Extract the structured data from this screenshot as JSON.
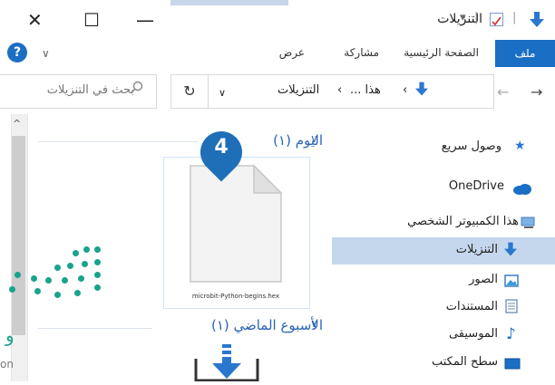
{
  "window": {
    "title": "التنزيلات",
    "minimize_glyph": "—",
    "maximize_glyph": "☐",
    "close_glyph": "✕",
    "accent_color": "#1a6fc4",
    "qa_separator": "|",
    "qa_arrow": "▾"
  },
  "ribbon": {
    "tabs": [
      "ملف",
      "الصفحة الرئيسية",
      "مشاركة",
      "عرض"
    ],
    "help_glyph": "?",
    "collapse_glyph": "∨"
  },
  "address": {
    "back_glyph": "←",
    "forward_glyph": "→",
    "up_glyph": "↑",
    "history_glyph": "∨",
    "breadcrumb_parent": "هذا ...",
    "breadcrumb_current": "التنزيلات",
    "separator": "›",
    "dropdown_glyph": "∨",
    "refresh_glyph": "↻",
    "search_placeholder": "بحث في التنزيلات"
  },
  "navigation_pane": {
    "items": [
      {
        "label": "وصول سريع",
        "icon": "star-icon"
      },
      {
        "label": "OneDrive",
        "icon": "cloud-icon"
      },
      {
        "label": "هذا الكمبيوتر الشخصي",
        "icon": "computer-icon"
      },
      {
        "label": "التنزيلات",
        "icon": "download-icon",
        "selected": true
      },
      {
        "label": "الصور",
        "icon": "pictures-icon"
      },
      {
        "label": "المستندات",
        "icon": "documents-icon"
      },
      {
        "label": "الموسيقى",
        "icon": "music-icon"
      },
      {
        "label": "سطح المكتب",
        "icon": "desktop-icon"
      }
    ]
  },
  "content": {
    "groups": [
      {
        "header": "اليوم (١)",
        "chevron": "∨"
      },
      {
        "header": "الأسبوع الماضي (١)",
        "chevron": "∨"
      }
    ],
    "file": {
      "name": "microbit-Python-begins.hex"
    },
    "callout_number": "4"
  },
  "watermark": {
    "text": "و",
    "sub": "on"
  },
  "scroll": {
    "up_glyph": "^"
  }
}
